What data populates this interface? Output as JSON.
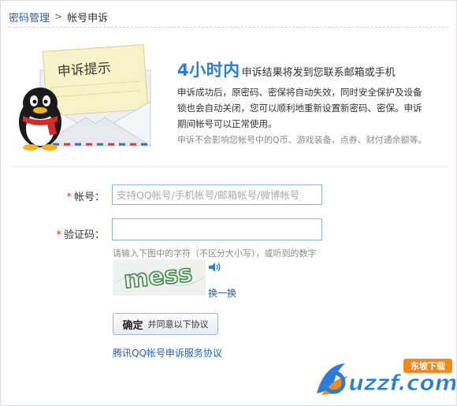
{
  "breadcrumb": {
    "parent": "密码管理",
    "separator": ">",
    "current": "帐号申诉"
  },
  "illustration": {
    "envelope_text": "申诉提示",
    "mascot": "qq-penguin"
  },
  "notice": {
    "highlight": "4小时内",
    "title_rest": "申诉结果将发到您联系邮箱或手机",
    "description": "申诉成功后，原密码、密保将自动失效，同时安全保护及设备锁也会自动关闭，您可以顺利地重新设置新密码、密保。申诉期间帐号可以正常使用。",
    "sub_note": "申诉不会影响您帐号中的Q币、游戏装备、点券、财付通余额等。"
  },
  "form": {
    "required_mark": "*",
    "account_label": "帐号：",
    "account_placeholder": "支持QQ帐号/手机帐号/邮箱帐号/微博帐号",
    "account_value": "",
    "code_label": "验证码：",
    "code_value": "",
    "code_hint": "请输入下图中的字符（不区分大小写），或听到的数字",
    "captcha_text": "mess",
    "audio_icon": "speaker-icon",
    "refresh_label": "换一换",
    "confirm_main": "确定",
    "confirm_sub": "并同意以下协议",
    "agreement_link": "腾讯QQ帐号申诉服务协议"
  },
  "watermark": {
    "brand": "uzzf.com",
    "badge": "东坡下载"
  },
  "colors": {
    "accent_blue": "#2a7dd6",
    "link": "#2b5da8",
    "required": "#e03030",
    "input_border": "#8ab4d9"
  }
}
